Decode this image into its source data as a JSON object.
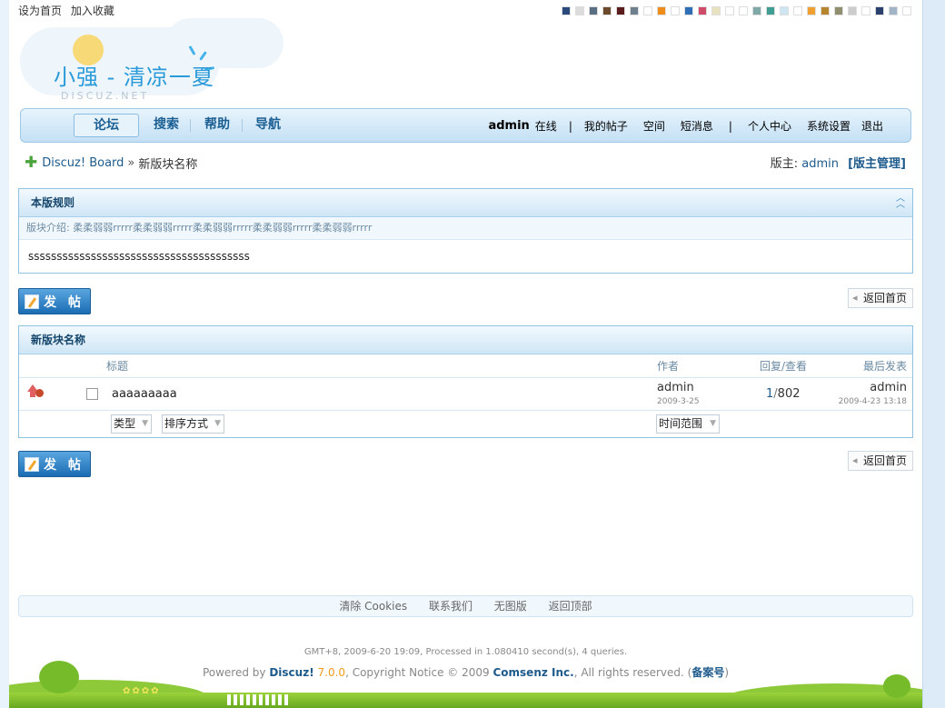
{
  "topbar": {
    "set_home": "设为首页",
    "bookmark": "加入收藏"
  },
  "style_swatches": [
    "#2a4a7b",
    "#dcdcdc",
    "#5b6f83",
    "#6b4a2b",
    "#5a1c1c",
    "#6e7f8e",
    "#ffffff",
    "#f08c1a",
    "#ffffff",
    "#2f6fb5",
    "#d04a6a",
    "#e8e2c0",
    "#ffffff",
    "#ffffff",
    "#7fa8a6",
    "#3f9d94",
    "#cfe6f2",
    "#ffffff",
    "#f0a030",
    "#b8852f",
    "#8f8f6f",
    "#cccccc",
    "#ffffff",
    "#2a3f6e",
    "#a2b4c8",
    "#ffffff"
  ],
  "logo": {
    "title": "小强 - 清凉一夏",
    "subtitle": "DISCUZ.NET"
  },
  "nav": {
    "tabs": [
      "论坛",
      "搜索",
      "帮助",
      "导航"
    ],
    "user": "admin",
    "status": "在线",
    "my_posts": "我的帖子",
    "space": "空间",
    "messages": "短消息",
    "user_center": "个人中心",
    "settings": "系统设置",
    "logout": "退出",
    "separator": "|"
  },
  "breadcrumb": {
    "home": "Discuz! Board",
    "sep": "»",
    "current": "新版块名称"
  },
  "moderator": {
    "label": "版主:",
    "name": "admin",
    "manage": "[版主管理]"
  },
  "rules": {
    "title": "本版规则",
    "intro": "版块介绍: 柔柔弱弱rrrrr柔柔弱弱rrrrr柔柔弱弱rrrrr柔柔弱弱rrrrr柔柔弱弱rrrrr",
    "body": "sssssssssssssssssssssssssssssssssssssss"
  },
  "buttons": {
    "post": "发 帖",
    "back_home": "返回首页"
  },
  "forum": {
    "title": "新版块名称",
    "columns": {
      "subject": "标题",
      "author": "作者",
      "replies_views": "回复/查看",
      "last_post": "最后发表"
    },
    "threads": [
      {
        "subject": "aaaaaaaaa",
        "author": "admin",
        "date": "2009-3-25",
        "replies": "1",
        "slash": "/",
        "views": "802",
        "last_author": "admin",
        "last_date": "2009-4-23 13:18"
      }
    ],
    "filters": {
      "type": "类型",
      "sort": "排序方式",
      "time": "时间范围"
    }
  },
  "footer": {
    "links": [
      "清除 Cookies",
      "联系我们",
      "无图版",
      "返回顶部"
    ],
    "process_info": "GMT+8, 2009-6-20 19:09, Processed in 1.080410 second(s), 4 queries.",
    "powered_prefix": "Powered by",
    "discuz": "Discuz!",
    "version": "7.0.0",
    "copyright_mid": ", Copyright Notice © 2009",
    "comsenz": "Comsenz Inc.",
    "rights": ", All rights reserved. (",
    "beian": "备案号",
    "close_paren": ")"
  }
}
